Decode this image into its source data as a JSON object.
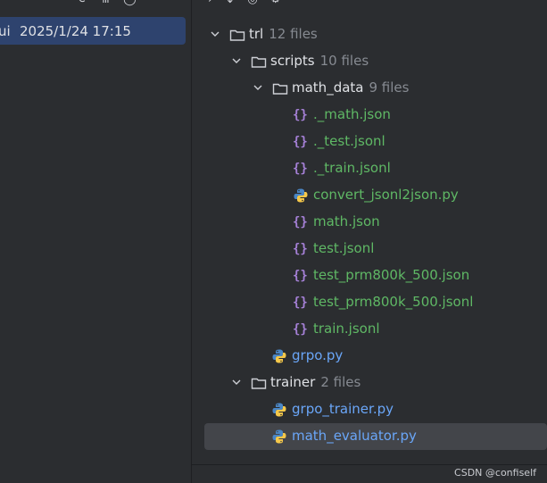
{
  "history": {
    "label_fragment": "ui",
    "timestamp": "2025/1/24 17:15"
  },
  "tree": {
    "root": {
      "name": "trl",
      "count": "12 files"
    },
    "scripts": {
      "name": "scripts",
      "count": "10 files"
    },
    "math_data": {
      "name": "math_data",
      "count": "9 files"
    },
    "math_data_files": [
      {
        "name": "._math.json",
        "type": "json"
      },
      {
        "name": "._test.jsonl",
        "type": "json"
      },
      {
        "name": "._train.jsonl",
        "type": "json"
      },
      {
        "name": "convert_jsonl2json.py",
        "type": "python"
      },
      {
        "name": "math.json",
        "type": "json"
      },
      {
        "name": "test.jsonl",
        "type": "json"
      },
      {
        "name": "test_prm800k_500.json",
        "type": "json"
      },
      {
        "name": "test_prm800k_500.jsonl",
        "type": "json"
      },
      {
        "name": "train.jsonl",
        "type": "json"
      }
    ],
    "scripts_files": [
      {
        "name": "grpo.py",
        "type": "python"
      }
    ],
    "trainer": {
      "name": "trainer",
      "count": "2 files"
    },
    "trainer_files": [
      {
        "name": "grpo_trainer.py",
        "type": "python"
      },
      {
        "name": "math_evaluator.py",
        "type": "python",
        "selected": true
      }
    ]
  },
  "json_icon_glyph": "{}",
  "colors": {
    "json_file": "#5fb865",
    "python_file": "#6aa6f8",
    "selection": "#43454a",
    "history_highlight": "#2e436e"
  },
  "watermark": "CSDN @confiself"
}
